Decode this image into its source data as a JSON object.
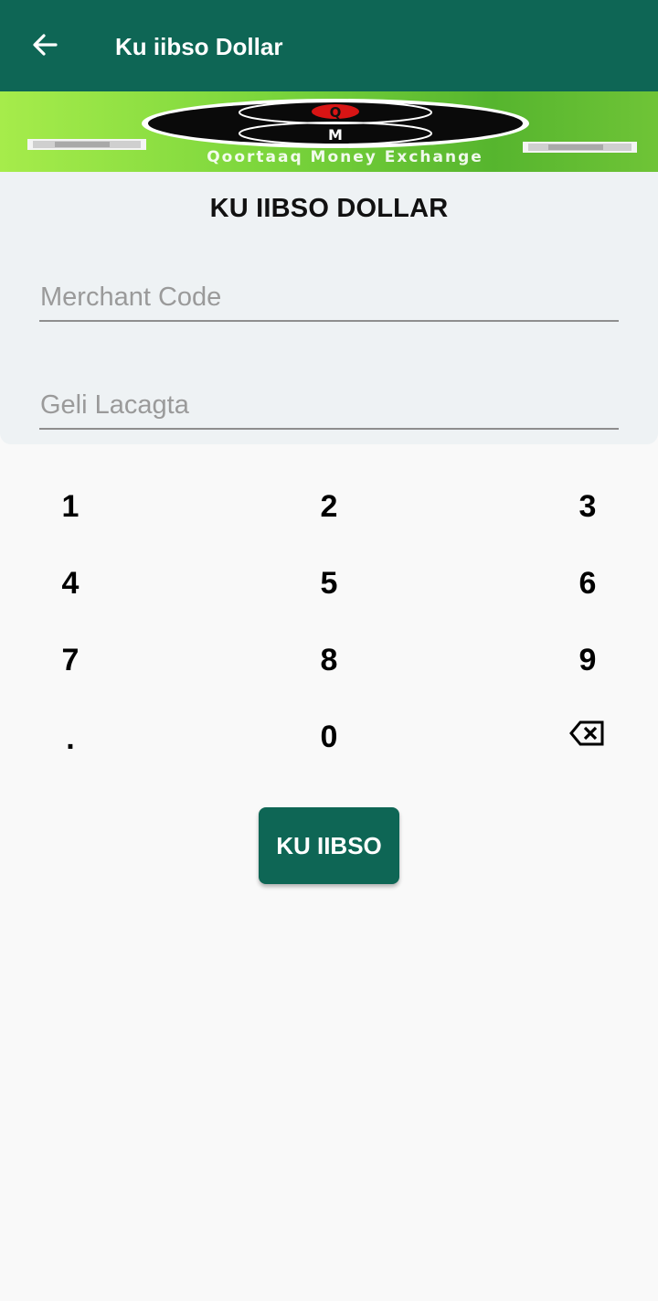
{
  "app_bar": {
    "title": "Ku iibso Dollar",
    "back_icon": "arrow-left-icon",
    "background": "#0e6655"
  },
  "banner": {
    "logo_letters": [
      "Q",
      "M"
    ],
    "caption": "Qoortaaq Money Exchange"
  },
  "form": {
    "heading": "KU IIBSO DOLLAR",
    "merchant_code": {
      "placeholder": "Merchant Code",
      "value": ""
    },
    "amount": {
      "placeholder": "Geli Lacagta",
      "value": ""
    }
  },
  "keypad": {
    "keys": [
      "1",
      "2",
      "3",
      "4",
      "5",
      "6",
      "7",
      "8",
      "9",
      ".",
      "0",
      "backspace"
    ],
    "backspace_icon": "backspace-icon"
  },
  "actions": {
    "submit_label": "KU IIBSO",
    "accent": "#0e6655"
  }
}
